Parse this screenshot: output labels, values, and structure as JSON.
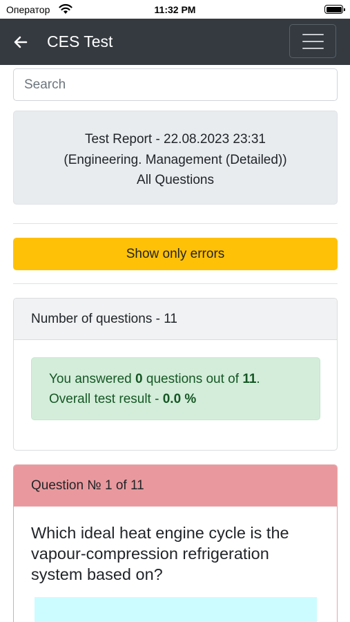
{
  "status_bar": {
    "carrier": "Оператор",
    "time": "11:32 PM"
  },
  "navbar": {
    "back_icon": "arrow-left-icon",
    "title": "CES Test",
    "menu_icon": "hamburger-icon"
  },
  "search": {
    "placeholder": "Search"
  },
  "report": {
    "line1": "Test Report - 22.08.2023 23:31",
    "line2": "(Engineering. Management (Detailed))",
    "line3": "All Questions"
  },
  "actions": {
    "show_errors_label": "Show only errors"
  },
  "summary": {
    "header": "Number of questions - 11",
    "answered_prefix": "You answered ",
    "answered_count": "0",
    "answered_middle": " questions out of ",
    "total_count": "11",
    "answered_suffix": ".",
    "result_prefix": "Overall test result - ",
    "result_value": "0.0 %"
  },
  "question": {
    "header": "Question № 1 of 11",
    "text": "Which ideal heat engine cycle is the vapour-compression refrigeration system based on?"
  },
  "colors": {
    "navbar_bg": "#343a40",
    "warning": "#ffc107",
    "success_bg": "#d4edda",
    "success_text": "#155724",
    "question_header_bg": "#e9999d",
    "answer_bg": "#ccfcff"
  }
}
